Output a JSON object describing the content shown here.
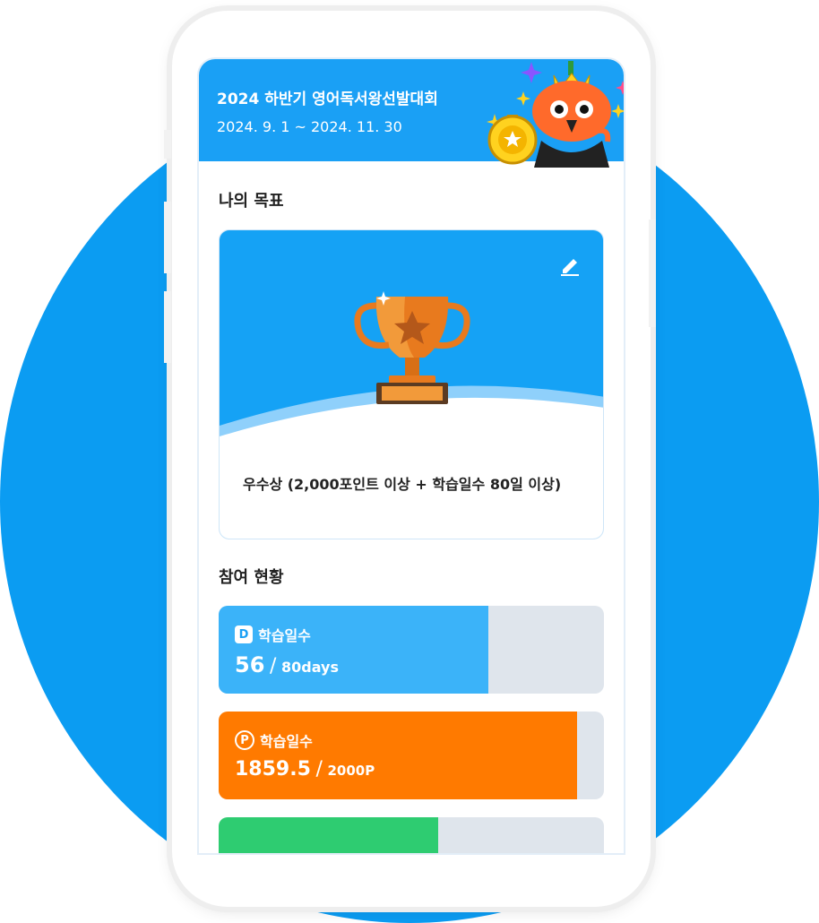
{
  "header": {
    "title": "2024 하반기 영어독서왕선발대회",
    "date_range": "2024. 9. 1 ~ 2024. 11. 30"
  },
  "goal": {
    "section_title": "나의 목표",
    "text": "우수상 (2,000포인트 이상 + 학습일수 80일 이상)",
    "edit_icon": "pencil-icon"
  },
  "participation": {
    "section_title": "참여 현황",
    "stats": [
      {
        "badge": "D",
        "label": "학습일수",
        "current": "56",
        "separator": "/",
        "target": "80days",
        "progress": 0.7,
        "color": "#3bb3f9"
      },
      {
        "badge": "P",
        "label": "학습일수",
        "current": "1859.5",
        "separator": "/",
        "target": "2000P",
        "progress": 0.93,
        "color": "#ff7a00"
      },
      {
        "progress": 0.57,
        "color": "#2ecc71"
      }
    ]
  },
  "colors": {
    "accent": "#0b9cf2",
    "header": "#1aa0f5",
    "orange": "#ff7a00",
    "track": "#dfe5ec"
  }
}
